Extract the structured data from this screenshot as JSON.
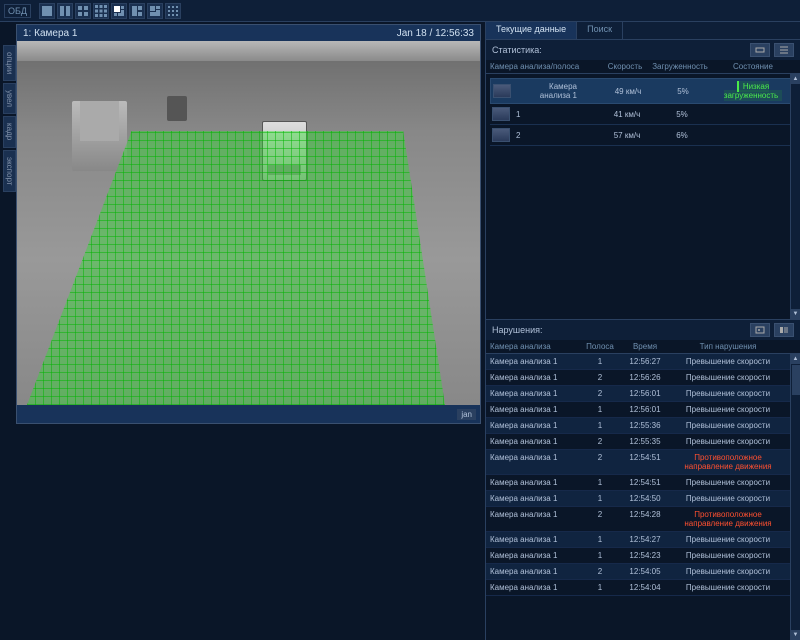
{
  "toolbar": {
    "label": "ОБД"
  },
  "video": {
    "title_left": "1: Камера 1",
    "title_right": "Jan 18 / 12:56:33",
    "footer_btn": "jan",
    "side_tabs": [
      "опции",
      "увел",
      "кадр",
      "экспорт"
    ]
  },
  "tabs": {
    "current": "Текущие данные",
    "search": "Поиск"
  },
  "stats": {
    "header": "Статистика:",
    "columns": {
      "c1": "Камера анализа/полоса",
      "c2": "Скорость",
      "c3": "Загруженность",
      "c4": "Состояние"
    },
    "rows": [
      {
        "name": "Камера анализа 1",
        "speed": "49 км/ч",
        "load": "5%",
        "status": "Низкая загруженность",
        "main": true
      },
      {
        "name": "1",
        "speed": "41 км/ч",
        "load": "5%",
        "status": "",
        "main": false
      },
      {
        "name": "2",
        "speed": "57 км/ч",
        "load": "6%",
        "status": "",
        "main": false
      }
    ]
  },
  "violations": {
    "header": "Нарушения:",
    "columns": {
      "c1": "Камера анализа",
      "c2": "Полоса",
      "c3": "Время",
      "c4": "Тип нарушения"
    },
    "rows": [
      {
        "cam": "Камера анализа 1",
        "lane": "1",
        "time": "12:56:27",
        "type": "Превышение скорости",
        "red": false
      },
      {
        "cam": "Камера анализа 1",
        "lane": "2",
        "time": "12:56:26",
        "type": "Превышение скорости",
        "red": false
      },
      {
        "cam": "Камера анализа 1",
        "lane": "2",
        "time": "12:56:01",
        "type": "Превышение скорости",
        "red": false
      },
      {
        "cam": "Камера анализа 1",
        "lane": "1",
        "time": "12:56:01",
        "type": "Превышение скорости",
        "red": false
      },
      {
        "cam": "Камера анализа 1",
        "lane": "1",
        "time": "12:55:36",
        "type": "Превышение скорости",
        "red": false
      },
      {
        "cam": "Камера анализа 1",
        "lane": "2",
        "time": "12:55:35",
        "type": "Превышение скорости",
        "red": false
      },
      {
        "cam": "Камера анализа 1",
        "lane": "2",
        "time": "12:54:51",
        "type": "Противоположное направление движения",
        "red": true
      },
      {
        "cam": "Камера анализа 1",
        "lane": "1",
        "time": "12:54:51",
        "type": "Превышение скорости",
        "red": false
      },
      {
        "cam": "Камера анализа 1",
        "lane": "1",
        "time": "12:54:50",
        "type": "Превышение скорости",
        "red": false
      },
      {
        "cam": "Камера анализа 1",
        "lane": "2",
        "time": "12:54:28",
        "type": "Противоположное направление движения",
        "red": true
      },
      {
        "cam": "Камера анализа 1",
        "lane": "1",
        "time": "12:54:27",
        "type": "Превышение скорости",
        "red": false
      },
      {
        "cam": "Камера анализа 1",
        "lane": "1",
        "time": "12:54:23",
        "type": "Превышение скорости",
        "red": false
      },
      {
        "cam": "Камера анализа 1",
        "lane": "2",
        "time": "12:54:05",
        "type": "Превышение скорости",
        "red": false
      },
      {
        "cam": "Камера анализа 1",
        "lane": "1",
        "time": "12:54:04",
        "type": "Превышение скорости",
        "red": false
      }
    ]
  }
}
